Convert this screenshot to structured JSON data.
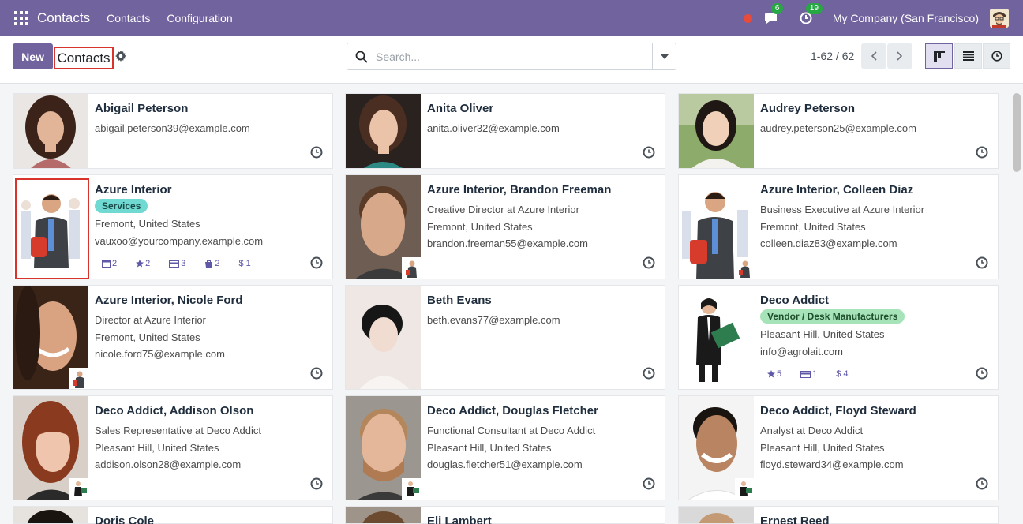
{
  "navbar": {
    "app_name": "Contacts",
    "menu": [
      "Contacts",
      "Configuration"
    ],
    "messages_count": "6",
    "activities_count": "19",
    "company": "My Company (San Francisco)"
  },
  "control": {
    "new_label": "New",
    "breadcrumb": "Contacts",
    "search_placeholder": "Search...",
    "pager": "1-62 / 62"
  },
  "colors": {
    "primary": "#71639e",
    "services_tag": "#6fd9d2",
    "vendor_tag": "#a7e3b8"
  },
  "cards": [
    {
      "name": "Abigail Peterson",
      "lines": [
        "abigail.peterson39@example.com"
      ]
    },
    {
      "name": "Anita Oliver",
      "lines": [
        "anita.oliver32@example.com"
      ]
    },
    {
      "name": "Audrey Peterson",
      "lines": [
        "audrey.peterson25@example.com"
      ]
    },
    {
      "name": "Azure Interior",
      "tag": "Services",
      "lines": [
        "Fremont, United States",
        "vauxoo@yourcompany.example.com"
      ],
      "stats": [
        "2",
        "2",
        "3",
        "2",
        "1"
      ]
    },
    {
      "name": "Azure Interior, Brandon Freeman",
      "lines": [
        "Creative Director at Azure Interior",
        "Fremont, United States",
        "brandon.freeman55@example.com"
      ]
    },
    {
      "name": "Azure Interior, Colleen Diaz",
      "lines": [
        "Business Executive at Azure Interior",
        "Fremont, United States",
        "colleen.diaz83@example.com"
      ]
    },
    {
      "name": "Azure Interior, Nicole Ford",
      "lines": [
        "Director at Azure Interior",
        "Fremont, United States",
        "nicole.ford75@example.com"
      ]
    },
    {
      "name": "Beth Evans",
      "lines": [
        "beth.evans77@example.com"
      ]
    },
    {
      "name": "Deco Addict",
      "tag": "Vendor / Desk Manufacturers",
      "lines": [
        "Pleasant Hill, United States",
        "info@agrolait.com"
      ],
      "stats": [
        "5",
        "1",
        "4"
      ]
    },
    {
      "name": "Deco Addict, Addison Olson",
      "lines": [
        "Sales Representative at Deco Addict",
        "Pleasant Hill, United States",
        "addison.olson28@example.com"
      ]
    },
    {
      "name": "Deco Addict, Douglas Fletcher",
      "lines": [
        "Functional Consultant at Deco Addict",
        "Pleasant Hill, United States",
        "douglas.fletcher51@example.com"
      ]
    },
    {
      "name": "Deco Addict, Floyd Steward",
      "lines": [
        "Analyst at Deco Addict",
        "Pleasant Hill, United States",
        "floyd.steward34@example.com"
      ]
    },
    {
      "name": "Doris Cole",
      "lines": []
    },
    {
      "name": "Eli Lambert",
      "lines": []
    },
    {
      "name": "Ernest Reed",
      "lines": []
    }
  ]
}
